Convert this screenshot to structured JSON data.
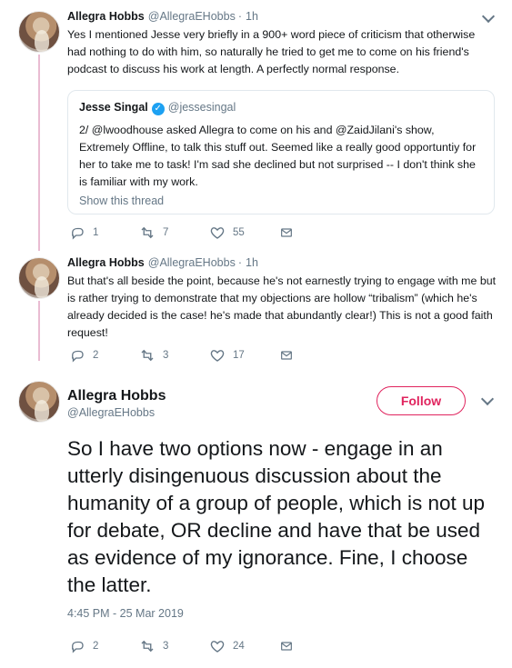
{
  "tweets": [
    {
      "name": "Allegra Hobbs",
      "handle": "@AllegraEHobbs",
      "separator": "·",
      "time": "1h",
      "text": "Yes I mentioned Jesse very briefly in a 900+ word piece of criticism that otherwise had nothing to do with him, so naturally he tried to get me to come on his friend's podcast to discuss his work at length. A perfectly normal response.",
      "quote": {
        "name": "Jesse Singal",
        "handle": "@jessesingal",
        "text": "2/ @lwoodhouse asked Allegra to come on his and @ZaidJilani's show, Extremely Offline, to talk this stuff out. Seemed like a really good opportuntiy for her to take me to task! I'm sad she declined but not surprised -- I don't think she is familiar with my work.",
        "link": "Show this thread"
      },
      "actions": {
        "replies": "1",
        "retweets": "7",
        "likes": "55"
      }
    },
    {
      "name": "Allegra Hobbs",
      "handle": "@AllegraEHobbs",
      "separator": "·",
      "time": "1h",
      "text": "But that's all beside the point, because he's not earnestly trying to engage with me but is rather trying to demonstrate that my objections are hollow “tribalism” (which he's already decided is the case! he's made that abundantly clear!) This is not a good faith request!",
      "actions": {
        "replies": "2",
        "retweets": "3",
        "likes": "17"
      }
    }
  ],
  "main": {
    "name": "Allegra Hobbs",
    "handle": "@AllegraEHobbs",
    "follow_label": "Follow",
    "text": "So I have two options now - engage in an utterly disingenuous discussion about the humanity of a group of people, which is not up for debate, OR decline and have that be used as evidence of my ignorance. Fine, I choose the latter.",
    "timestamp": "4:45 PM - 25 Mar 2019",
    "actions": {
      "replies": "2",
      "retweets": "3",
      "likes": "24"
    }
  },
  "icons": [
    "avatar",
    "verified-icon",
    "reply-icon",
    "retweet-icon",
    "like-icon",
    "dm-icon",
    "chevron-down-icon"
  ],
  "colors": {
    "link_blue": "#1da1f2",
    "follow_red": "#e0245e",
    "muted_gray": "#657786",
    "thread_line": "#e9bcd2"
  }
}
